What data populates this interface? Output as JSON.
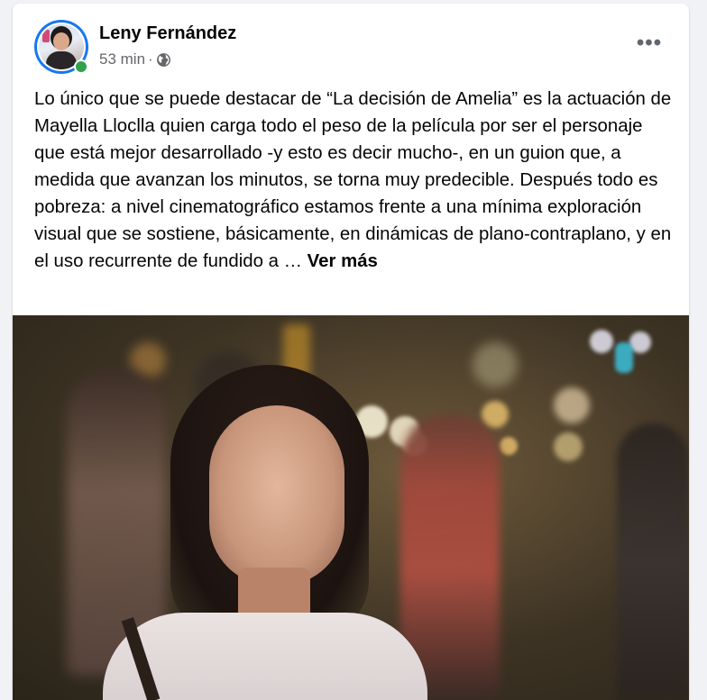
{
  "post": {
    "author": "Leny Fernández",
    "time": "53 min",
    "separator": "·",
    "privacy_icon": "globe-icon",
    "more_icon": "more-options-icon",
    "text": "Lo único que se puede destacar de “La decisión de Amelia” es la actuación de Mayella Lloclla quien carga todo el peso de la película por ser el personaje que está mejor desarrollado -y esto es decir mucho-, en un guion que, a medida que avanzan los minutos, se torna muy predecible. Después todo es pobreza: a nivel cinematográfico estamos frente a una mínima exploración visual que se sostiene, básicamente, en dinámicas de plano-contraplano, y en el uso recurrente de fundido a …",
    "see_more": "Ver más",
    "online_color": "#31a24c",
    "avatar_ring_color": "#1877f2"
  }
}
